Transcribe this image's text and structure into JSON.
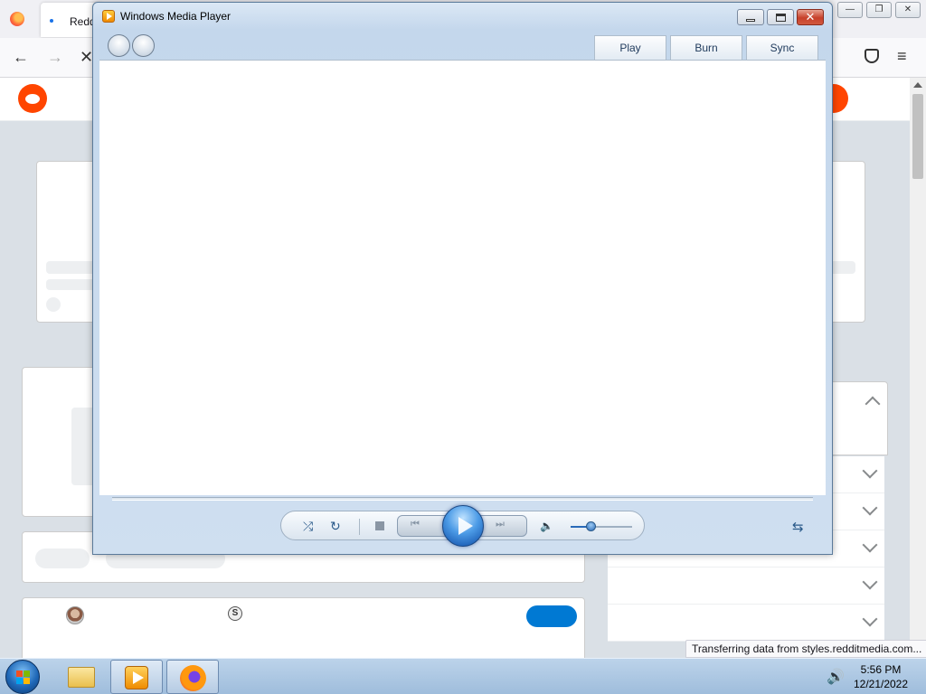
{
  "firefox": {
    "tab_title": "Reddit",
    "status_text": "Transferring data from styles.redditmedia.com...",
    "caption_buttons": {
      "minimize": "—",
      "restore": "❐",
      "close": "✕"
    },
    "nav": {
      "back": "←",
      "forward": "→",
      "stop": "✕",
      "menu": "≡"
    }
  },
  "reddit": {
    "coin_glyph": "S",
    "colors": {
      "brand": "#ff4500",
      "join": "#0079d3"
    }
  },
  "wmp": {
    "title": "Windows Media Player",
    "tabs": [
      {
        "label": "Play"
      },
      {
        "label": "Burn"
      },
      {
        "label": "Sync"
      }
    ],
    "caption": {
      "close": "✕"
    },
    "controls": {
      "shuffle": "⤮",
      "repeat": "↻",
      "previous": "⏮",
      "next": "⏭",
      "volume_icon": "🔈",
      "switch_view": "⇆",
      "volume_level": 0.32
    }
  },
  "taskbar": {
    "time": "5:56 PM",
    "date": "12/21/2022",
    "tray_volume": "🔊"
  }
}
